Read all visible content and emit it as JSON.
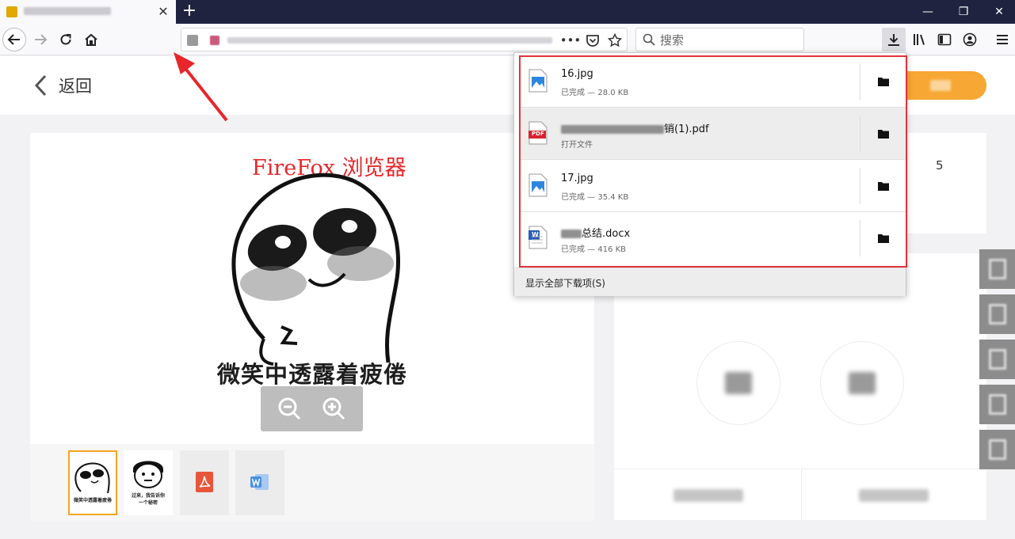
{
  "browser": {
    "tab_close_glyph": "✕",
    "new_tab_glyph": "+",
    "window_controls": [
      "—",
      "❐",
      "✕"
    ],
    "url_more_glyph": "•••",
    "search_placeholder": "搜索"
  },
  "page": {
    "back_label": "返回",
    "annotation": "FireFox 浏览器",
    "meme_caption": "微笑中透露着疲倦",
    "right_number": "5",
    "thumbnails": [
      {
        "caption": "微笑中透露着疲倦",
        "selected": true
      },
      {
        "caption_line1": "过来，我告诉你",
        "caption_line2": "一个秘密"
      },
      {
        "type": "pdf-icon"
      },
      {
        "type": "word-icon"
      }
    ]
  },
  "downloads": {
    "items": [
      {
        "name": "16.jpg",
        "status": "已完成 — 28.0 KB",
        "icon": "image-file-icon"
      },
      {
        "name_visible": "销(1).pdf",
        "status": "打开文件",
        "icon": "pdf-file-icon",
        "pdf_badge": "PDF"
      },
      {
        "name": "17.jpg",
        "status": "已完成 — 35.4 KB",
        "icon": "image-file-icon"
      },
      {
        "name_visible": "总结.docx",
        "status": "已完成 — 416 KB",
        "icon": "word-file-icon",
        "word_badge": "W"
      }
    ],
    "footer": "显示全部下载项(S)"
  },
  "colors": {
    "tabbar": "#202340",
    "accent_orange": "#f7a733",
    "highlight_red": "#e1333c"
  }
}
